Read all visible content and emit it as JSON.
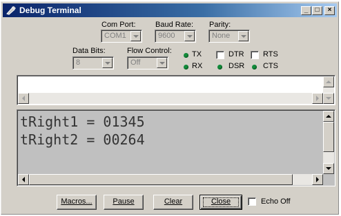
{
  "window": {
    "title": "Debug Terminal"
  },
  "titlebar_buttons": {
    "minimize": "_",
    "maximize": "□",
    "close": "×"
  },
  "settings": {
    "com_port": {
      "label": "Com Port:",
      "value": "COM1"
    },
    "baud_rate": {
      "label": "Baud Rate:",
      "value": "9600"
    },
    "parity": {
      "label": "Parity:",
      "value": "None"
    },
    "data_bits": {
      "label": "Data Bits:",
      "value": "8"
    },
    "flow_control": {
      "label": "Flow Control:",
      "value": "Off"
    }
  },
  "indicators": {
    "tx": "TX",
    "rx": "RX",
    "dtr": "DTR",
    "dsr": "DSR",
    "rts": "RTS",
    "cts": "CTS",
    "led_color": "#138b3b"
  },
  "receive": {
    "lines": [
      "tRight1 = 01345",
      "tRight2 = 00264"
    ],
    "background": "#c0c0c0"
  },
  "buttons": {
    "macros": "Macros...",
    "pause": "Pause",
    "clear": "Clear",
    "close": "Close"
  },
  "echo_off": {
    "label": "Echo Off",
    "checked": false
  }
}
